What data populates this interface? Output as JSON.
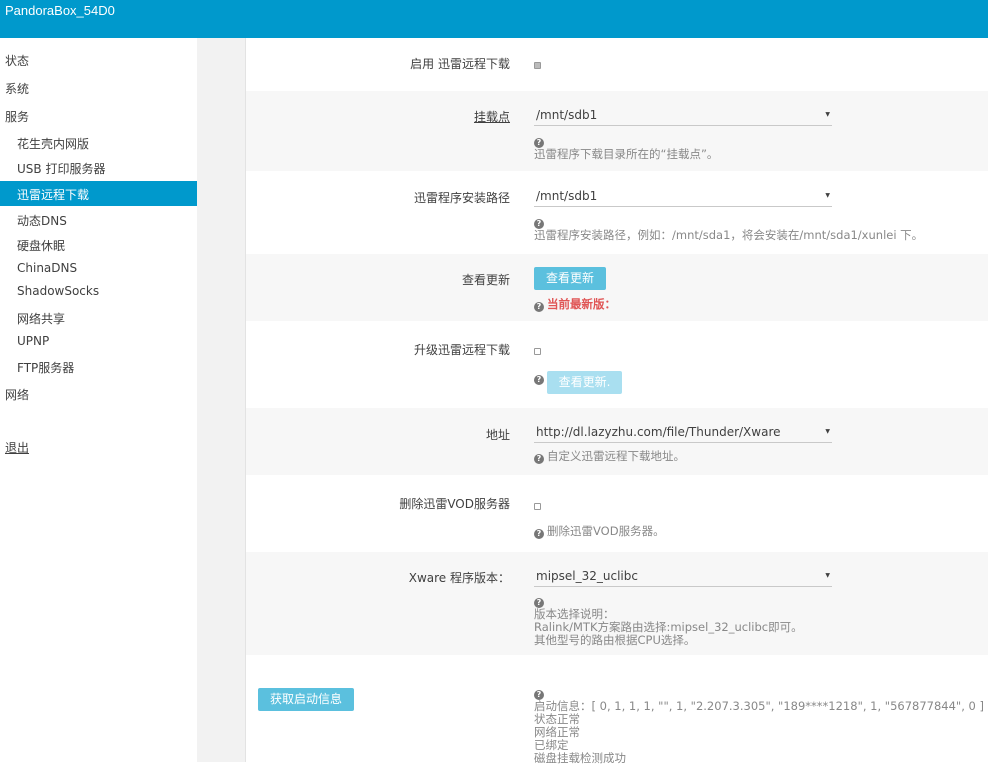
{
  "header": {
    "brand": "PandoraBox_54D0"
  },
  "sidebar": {
    "items": [
      {
        "label": "状态"
      },
      {
        "label": "系统"
      },
      {
        "label": "服务"
      },
      {
        "label": "花生壳内网版"
      },
      {
        "label": "USB 打印服务器"
      },
      {
        "label": "迅雷远程下载"
      },
      {
        "label": "动态DNS"
      },
      {
        "label": "硬盘休眠"
      },
      {
        "label": "ChinaDNS"
      },
      {
        "label": "ShadowSocks"
      },
      {
        "label": "网络共享"
      },
      {
        "label": "UPNP"
      },
      {
        "label": "FTP服务器"
      },
      {
        "label": "网络"
      },
      {
        "label": "退出"
      }
    ]
  },
  "form": {
    "enable": {
      "label": "启用 迅雷远程下载",
      "checked": true
    },
    "mount": {
      "label": "挂载点",
      "value": "/mnt/sdb1",
      "help": "迅雷程序下载目录所在的“挂载点”。"
    },
    "install": {
      "label": "迅雷程序安装路径",
      "value": "/mnt/sdb1",
      "help": "迅雷程序安装路径，例如：/mnt/sda1，将会安装在/mnt/sda1/xunlei 下。"
    },
    "check": {
      "label": "查看更新",
      "button": "查看更新",
      "status": "当前最新版："
    },
    "upgrade": {
      "label": "升级迅雷远程下载",
      "button": "查看更新."
    },
    "address": {
      "label": "地址",
      "value": "http://dl.lazyzhu.com/file/Thunder/Xware",
      "help": "自定义迅雷远程下载地址。"
    },
    "vod": {
      "label": "删除迅雷VOD服务器",
      "help": "删除迅雷VOD服务器。"
    },
    "version": {
      "label": "Xware 程序版本：",
      "value": "mipsel_32_uclibc",
      "help_lines": [
        "版本选择说明：",
        "Ralink/MTK方案路由选择:mipsel_32_uclibc即可。",
        "其他型号的路由根据CPU选择。"
      ]
    },
    "startinfo": {
      "button": "获取启动信息",
      "lines": [
        "启动信息：[ 0, 1, 1, 1, \"\", 1, \"2.207.3.305\", \"189****1218\", 1, \"567877844\", 0 ]",
        "状态正常",
        "网络正常",
        "已绑定",
        "磁盘挂载检测成功"
      ]
    }
  }
}
